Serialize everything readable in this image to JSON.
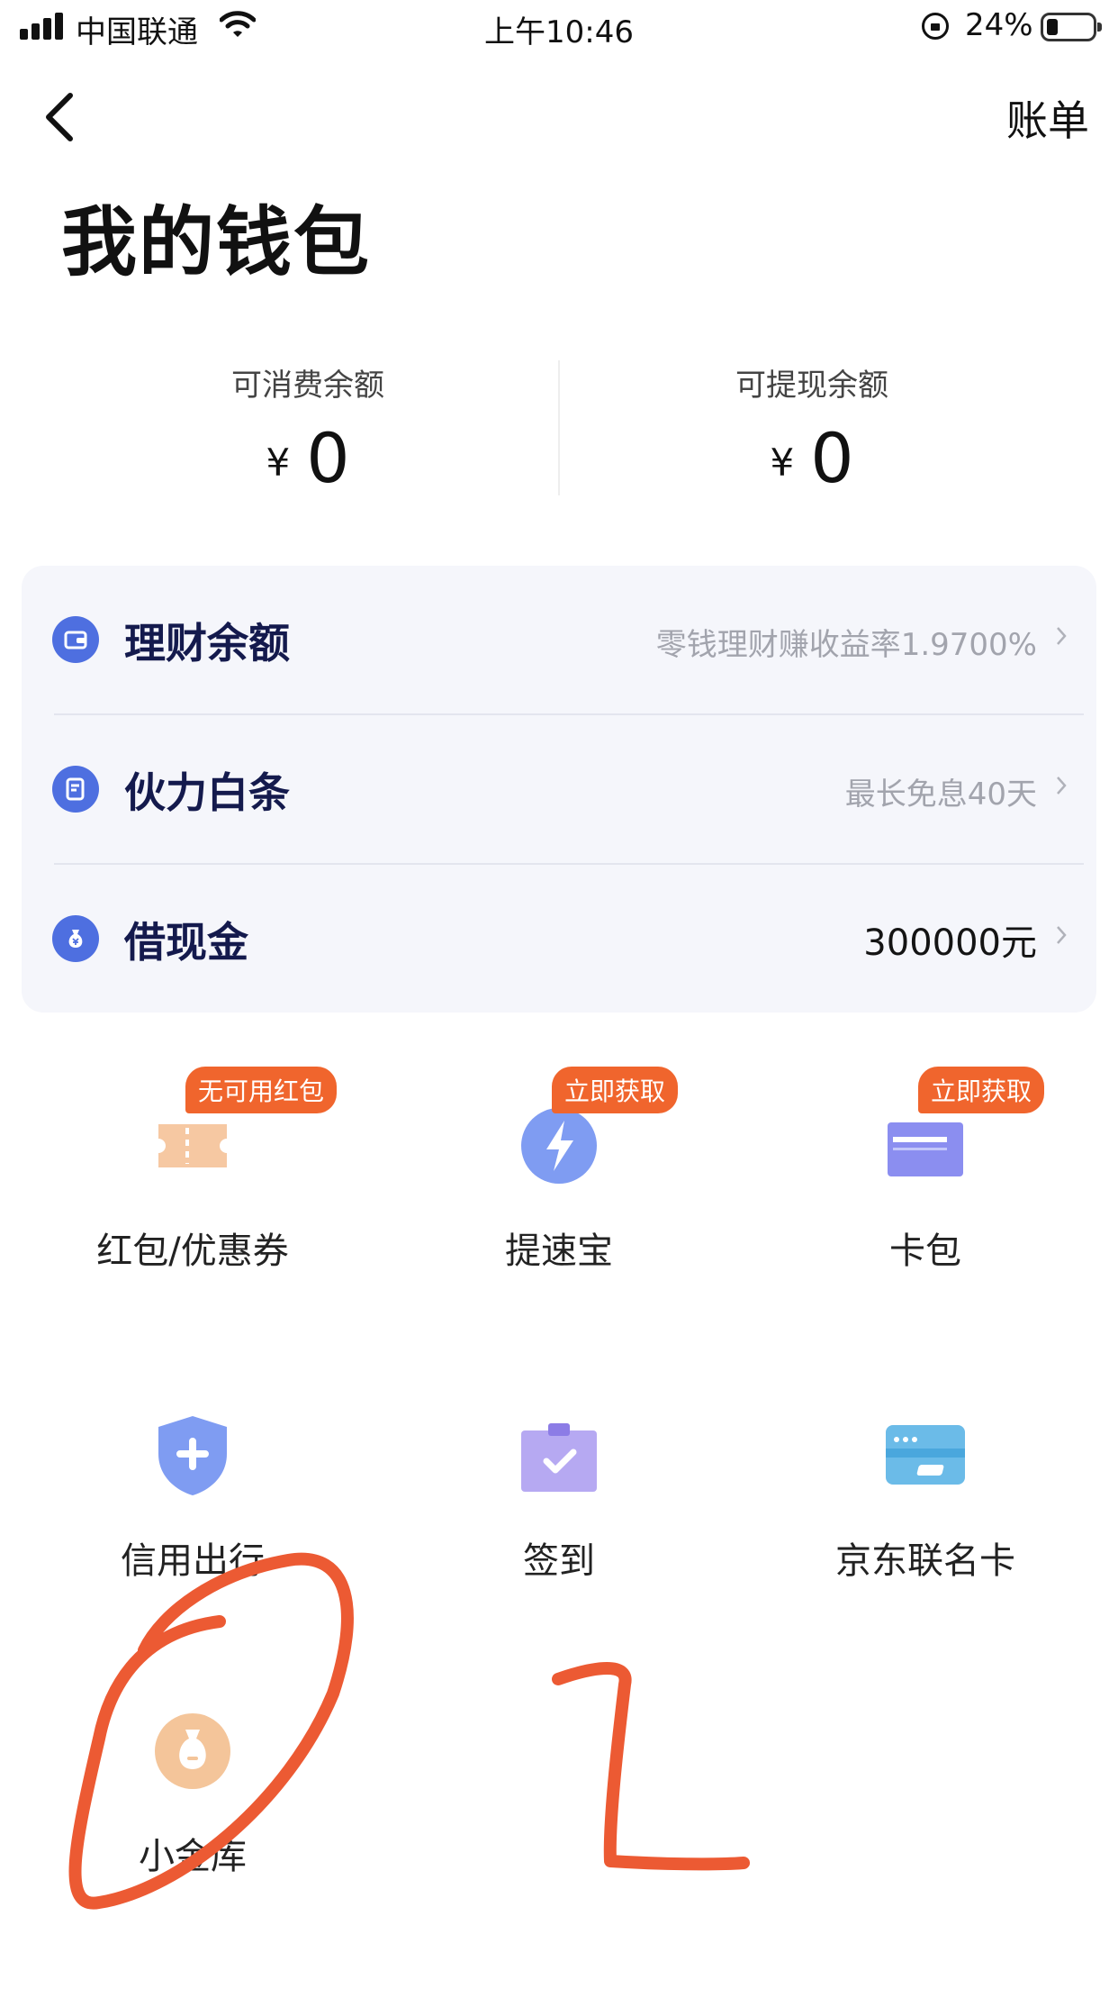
{
  "status_bar": {
    "carrier": "中国联通",
    "time": "上午10:46",
    "battery": "24%"
  },
  "nav": {
    "back_icon": "chevron-left-icon",
    "bill_label": "账单"
  },
  "page_title": "我的钱包",
  "balances": [
    {
      "label": "可消费余额",
      "currency": "¥",
      "amount": "0"
    },
    {
      "label": "可提现余额",
      "currency": "¥",
      "amount": "0"
    }
  ],
  "list": [
    {
      "icon": "wallet-icon",
      "title": "理财余额",
      "subtitle": "零钱理财赚收益率1.9700%"
    },
    {
      "icon": "bill-icon",
      "title": "伙力白条",
      "subtitle": "最长免息40天"
    },
    {
      "icon": "money-bag-icon",
      "title": "借现金",
      "subtitle": "300000元"
    }
  ],
  "grid": [
    {
      "icon": "coupon-icon",
      "label": "红包/优惠券",
      "badge": "无可用红包"
    },
    {
      "icon": "lightning-icon",
      "label": "提速宝",
      "badge": "立即获取"
    },
    {
      "icon": "card-wallet-icon",
      "label": "卡包",
      "badge": "立即获取"
    },
    {
      "icon": "shield-icon",
      "label": "信用出行"
    },
    {
      "icon": "calendar-check-icon",
      "label": "签到"
    },
    {
      "icon": "credit-card-icon",
      "label": "京东联名卡"
    },
    {
      "icon": "gold-bag-icon",
      "label": "小金库"
    }
  ],
  "colors": {
    "accent_blue": "#4e6fe0",
    "badge_orange": "#f0652d",
    "card_bg": "#f5f6fb",
    "annotation_red": "#ec5a33"
  }
}
